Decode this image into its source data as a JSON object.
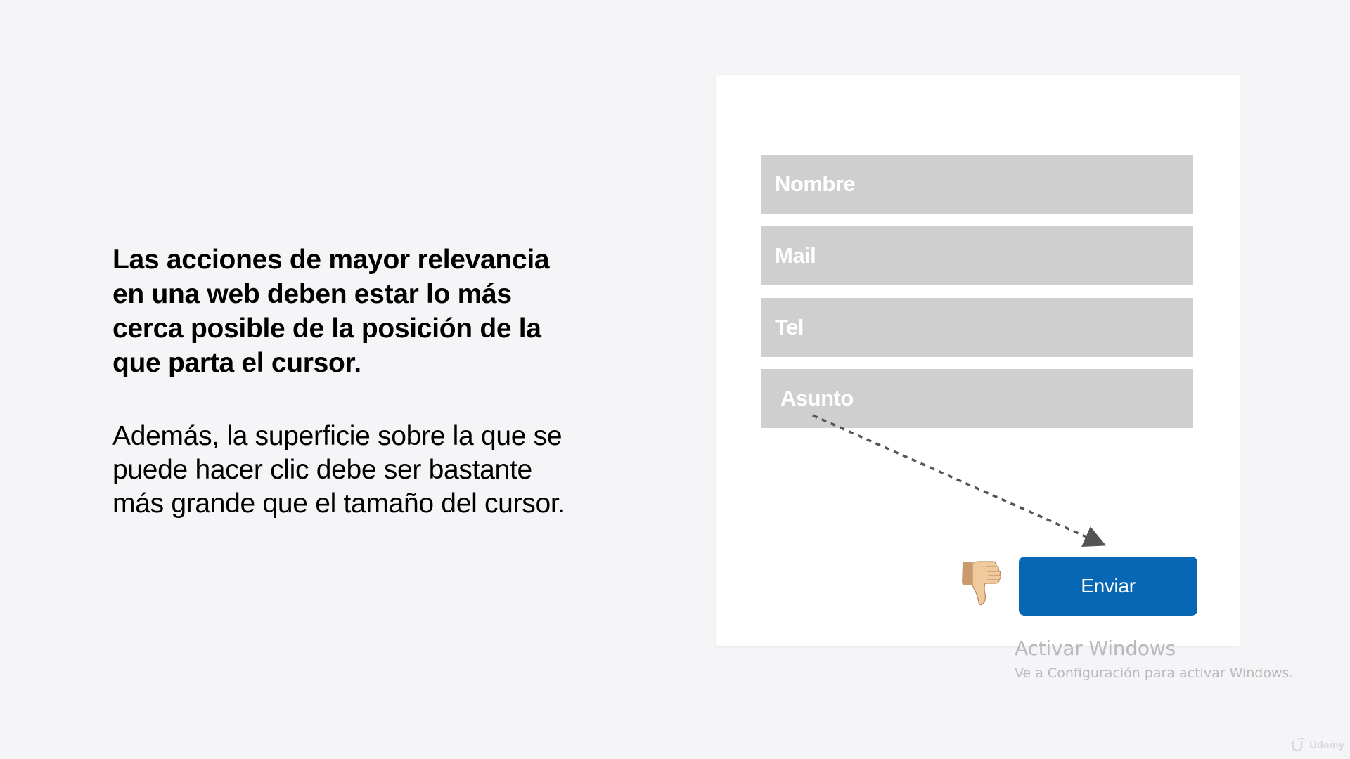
{
  "slide": {
    "headline_lines": [
      "Las acciones de mayor relevancia",
      "en una web deben estar lo más",
      "cerca posible de la posición de la",
      "que parta el cursor."
    ],
    "body_lines": [
      "Además, la superficie sobre la que se",
      "puede hacer clic debe ser bastante",
      "más grande que el tamaño del cursor."
    ]
  },
  "form": {
    "fields": [
      {
        "label": "Nombre"
      },
      {
        "label": "Mail"
      },
      {
        "label": "Tel"
      },
      {
        "label": "Asunto"
      }
    ],
    "submit_label": "Enviar",
    "feedback_icon": "thumbs-down-icon"
  },
  "watermark": {
    "title": "Activar Windows",
    "subtitle": "Ve a Configuración para activar Windows."
  },
  "brand": {
    "name": "Udemy",
    "icon": "udemy-logo-icon"
  },
  "colors": {
    "background": "#f5f5f7",
    "field_fill": "#cfcfcf",
    "button": "#0867b5",
    "arrow": "#555555"
  }
}
